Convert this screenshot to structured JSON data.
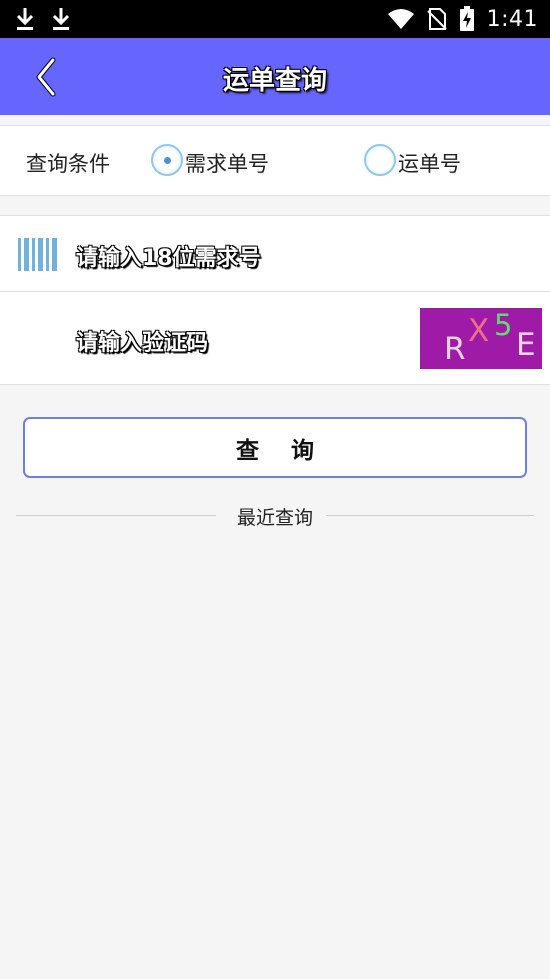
{
  "status_bar": {
    "time": "1:41",
    "left_icons": [
      "download-icon",
      "download-icon"
    ],
    "right_icons": [
      "wifi-icon",
      "no-sim-icon",
      "battery-charging-icon"
    ]
  },
  "header": {
    "title": "运单查询",
    "back_icon": "chevron-left-icon",
    "color": "#6666ff"
  },
  "query_condition": {
    "label": "查询条件",
    "options": [
      {
        "label": "需求单号",
        "selected": true
      },
      {
        "label": "运单号",
        "selected": false
      }
    ]
  },
  "demand_input": {
    "placeholder": "请输入18位需求号",
    "icon": "barcode-icon"
  },
  "captcha_input": {
    "placeholder": "请输入验证码",
    "captcha_chars": [
      "R",
      "X",
      "5",
      "E"
    ]
  },
  "query_button": {
    "label": "查询"
  },
  "recent": {
    "label": "最近查询"
  }
}
